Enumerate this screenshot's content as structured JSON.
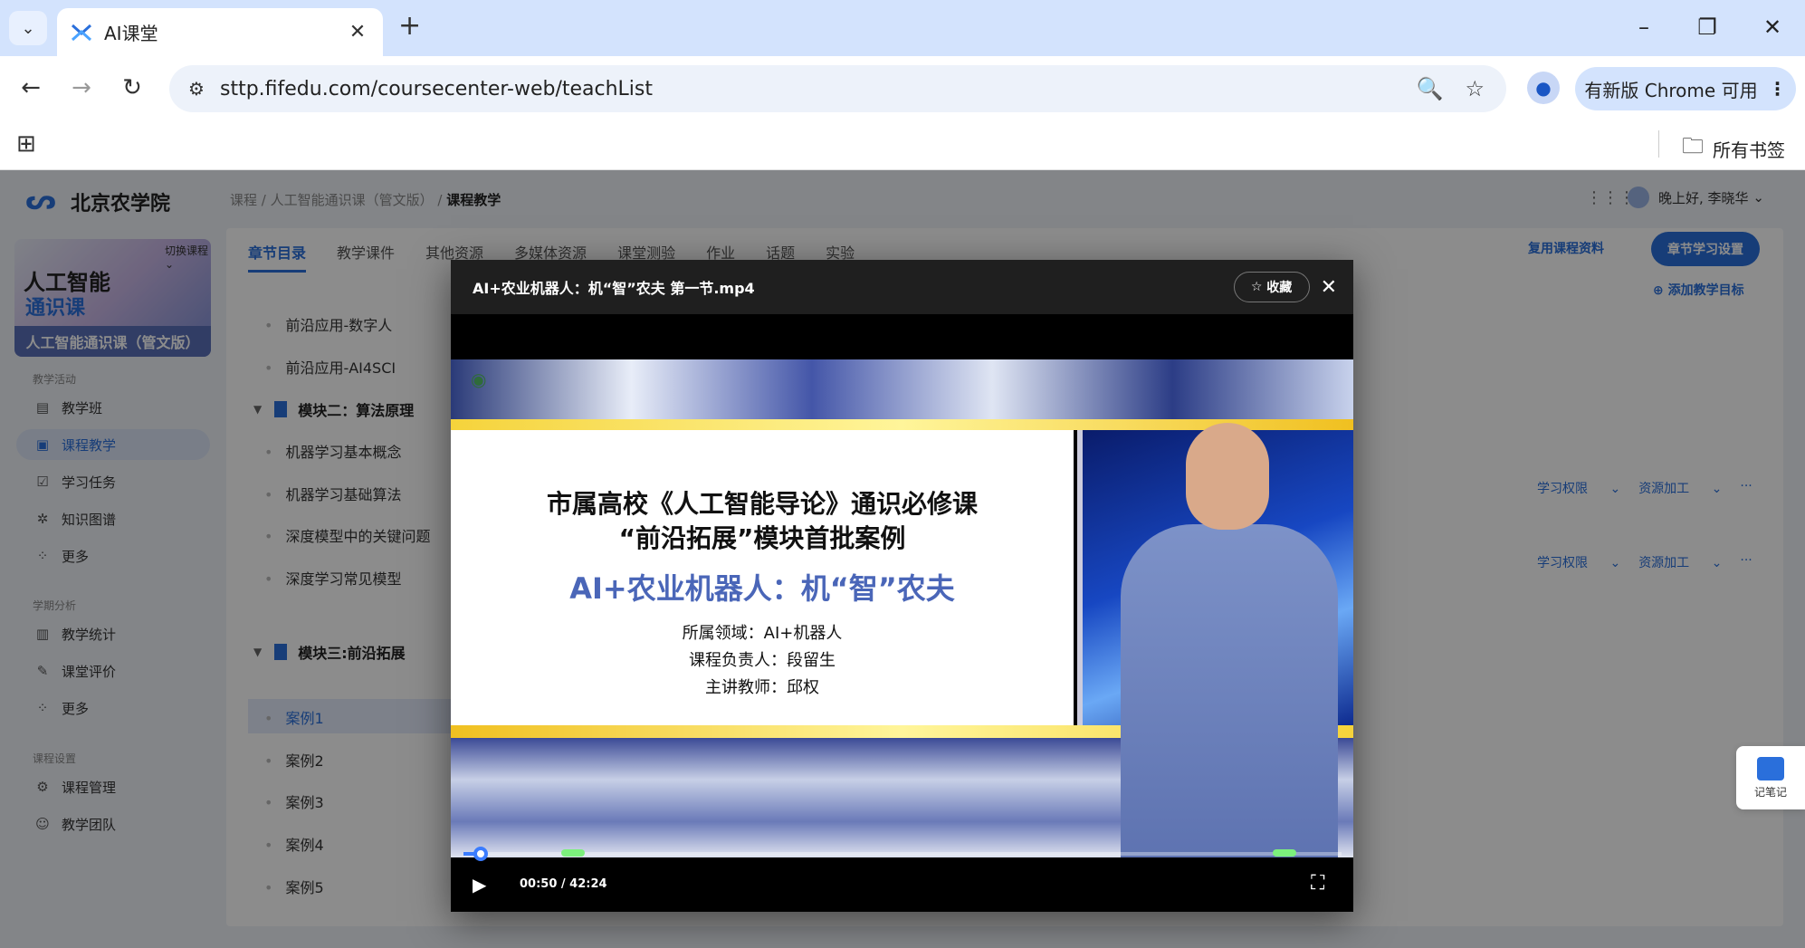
{
  "browser": {
    "tab_title": "AI课堂",
    "url": "sttp.fifedu.com/coursecenter-web/teachList",
    "update_label": "有新版 Chrome 可用",
    "bookmarks_folder": "所有书签"
  },
  "app": {
    "school_name": "北京农学院",
    "breadcrumb": [
      "课程",
      "人工智能通识课（管文版）",
      "课程教学"
    ],
    "greeting": "晚上好, 李晓华",
    "course_card": {
      "switch_label": "切换课程",
      "line1": "人工智能",
      "line2": "通识课",
      "band": "人工智能通识课（管文版）"
    },
    "sidebar": {
      "groups": [
        {
          "title": "教学活动",
          "items": [
            "教学班",
            "课程教学",
            "学习任务",
            "知识图谱",
            "更多"
          ]
        },
        {
          "title": "学期分析",
          "items": [
            "教学统计",
            "课堂评价",
            "更多"
          ]
        },
        {
          "title": "课程设置",
          "items": [
            "课程管理",
            "教学团队"
          ]
        }
      ]
    },
    "tabs": [
      "章节目录",
      "教学课件",
      "其他资源",
      "多媒体资源",
      "课堂测验",
      "作业",
      "话题",
      "实验"
    ],
    "reuse_label": "复用课程资料",
    "chapter_setting_label": "章节学习设置",
    "add_goal_label": "添加教学目标",
    "tree": {
      "items_top": [
        "前沿应用-数字人",
        "前沿应用-AI4SCI"
      ],
      "module2": "模块二：算法原理",
      "module2_items": [
        "机器学习基本概念",
        "机器学习基础算法",
        "深度模型中的关键问题",
        "深度学习常见模型"
      ],
      "module3": "模块三:前沿拓展",
      "module3_items": [
        "案例1",
        "案例2",
        "案例3",
        "案例4",
        "案例5"
      ]
    },
    "row_actions": {
      "permission": "学习权限",
      "process": "资源加工",
      "more": "···"
    },
    "notes_label": "记笔记"
  },
  "player": {
    "title": "AI+农业机器人：机“智”农夫 第一节.mp4",
    "fav_label": "收藏",
    "slide_line1": "市属高校《人工智能导论》通识必修课",
    "slide_line2": "“前沿拓展”模块首批案例",
    "slide_line3": "AI+农业机器人：机“智”农夫",
    "slide_field": "所属领域：AI+机器人",
    "slide_owner": "课程负责人：段留生",
    "slide_teacher": "主讲教师：邱权",
    "time": "00:50 / 42:24",
    "progress": 0.0197
  }
}
